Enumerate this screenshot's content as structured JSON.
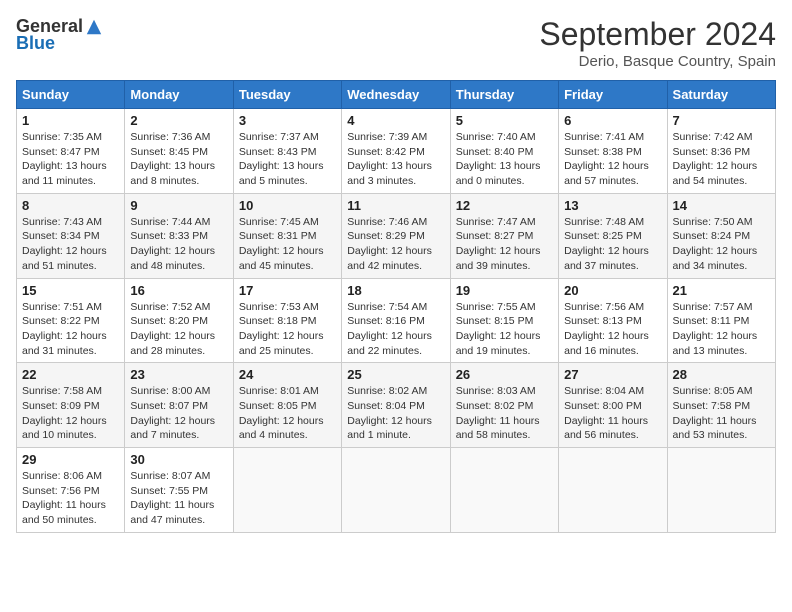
{
  "logo": {
    "general": "General",
    "blue": "Blue"
  },
  "title": "September 2024",
  "subtitle": "Derio, Basque Country, Spain",
  "headers": [
    "Sunday",
    "Monday",
    "Tuesday",
    "Wednesday",
    "Thursday",
    "Friday",
    "Saturday"
  ],
  "weeks": [
    [
      {
        "day": "1",
        "sunrise": "Sunrise: 7:35 AM",
        "sunset": "Sunset: 8:47 PM",
        "daylight": "Daylight: 13 hours and 11 minutes."
      },
      {
        "day": "2",
        "sunrise": "Sunrise: 7:36 AM",
        "sunset": "Sunset: 8:45 PM",
        "daylight": "Daylight: 13 hours and 8 minutes."
      },
      {
        "day": "3",
        "sunrise": "Sunrise: 7:37 AM",
        "sunset": "Sunset: 8:43 PM",
        "daylight": "Daylight: 13 hours and 5 minutes."
      },
      {
        "day": "4",
        "sunrise": "Sunrise: 7:39 AM",
        "sunset": "Sunset: 8:42 PM",
        "daylight": "Daylight: 13 hours and 3 minutes."
      },
      {
        "day": "5",
        "sunrise": "Sunrise: 7:40 AM",
        "sunset": "Sunset: 8:40 PM",
        "daylight": "Daylight: 13 hours and 0 minutes."
      },
      {
        "day": "6",
        "sunrise": "Sunrise: 7:41 AM",
        "sunset": "Sunset: 8:38 PM",
        "daylight": "Daylight: 12 hours and 57 minutes."
      },
      {
        "day": "7",
        "sunrise": "Sunrise: 7:42 AM",
        "sunset": "Sunset: 8:36 PM",
        "daylight": "Daylight: 12 hours and 54 minutes."
      }
    ],
    [
      {
        "day": "8",
        "sunrise": "Sunrise: 7:43 AM",
        "sunset": "Sunset: 8:34 PM",
        "daylight": "Daylight: 12 hours and 51 minutes."
      },
      {
        "day": "9",
        "sunrise": "Sunrise: 7:44 AM",
        "sunset": "Sunset: 8:33 PM",
        "daylight": "Daylight: 12 hours and 48 minutes."
      },
      {
        "day": "10",
        "sunrise": "Sunrise: 7:45 AM",
        "sunset": "Sunset: 8:31 PM",
        "daylight": "Daylight: 12 hours and 45 minutes."
      },
      {
        "day": "11",
        "sunrise": "Sunrise: 7:46 AM",
        "sunset": "Sunset: 8:29 PM",
        "daylight": "Daylight: 12 hours and 42 minutes."
      },
      {
        "day": "12",
        "sunrise": "Sunrise: 7:47 AM",
        "sunset": "Sunset: 8:27 PM",
        "daylight": "Daylight: 12 hours and 39 minutes."
      },
      {
        "day": "13",
        "sunrise": "Sunrise: 7:48 AM",
        "sunset": "Sunset: 8:25 PM",
        "daylight": "Daylight: 12 hours and 37 minutes."
      },
      {
        "day": "14",
        "sunrise": "Sunrise: 7:50 AM",
        "sunset": "Sunset: 8:24 PM",
        "daylight": "Daylight: 12 hours and 34 minutes."
      }
    ],
    [
      {
        "day": "15",
        "sunrise": "Sunrise: 7:51 AM",
        "sunset": "Sunset: 8:22 PM",
        "daylight": "Daylight: 12 hours and 31 minutes."
      },
      {
        "day": "16",
        "sunrise": "Sunrise: 7:52 AM",
        "sunset": "Sunset: 8:20 PM",
        "daylight": "Daylight: 12 hours and 28 minutes."
      },
      {
        "day": "17",
        "sunrise": "Sunrise: 7:53 AM",
        "sunset": "Sunset: 8:18 PM",
        "daylight": "Daylight: 12 hours and 25 minutes."
      },
      {
        "day": "18",
        "sunrise": "Sunrise: 7:54 AM",
        "sunset": "Sunset: 8:16 PM",
        "daylight": "Daylight: 12 hours and 22 minutes."
      },
      {
        "day": "19",
        "sunrise": "Sunrise: 7:55 AM",
        "sunset": "Sunset: 8:15 PM",
        "daylight": "Daylight: 12 hours and 19 minutes."
      },
      {
        "day": "20",
        "sunrise": "Sunrise: 7:56 AM",
        "sunset": "Sunset: 8:13 PM",
        "daylight": "Daylight: 12 hours and 16 minutes."
      },
      {
        "day": "21",
        "sunrise": "Sunrise: 7:57 AM",
        "sunset": "Sunset: 8:11 PM",
        "daylight": "Daylight: 12 hours and 13 minutes."
      }
    ],
    [
      {
        "day": "22",
        "sunrise": "Sunrise: 7:58 AM",
        "sunset": "Sunset: 8:09 PM",
        "daylight": "Daylight: 12 hours and 10 minutes."
      },
      {
        "day": "23",
        "sunrise": "Sunrise: 8:00 AM",
        "sunset": "Sunset: 8:07 PM",
        "daylight": "Daylight: 12 hours and 7 minutes."
      },
      {
        "day": "24",
        "sunrise": "Sunrise: 8:01 AM",
        "sunset": "Sunset: 8:05 PM",
        "daylight": "Daylight: 12 hours and 4 minutes."
      },
      {
        "day": "25",
        "sunrise": "Sunrise: 8:02 AM",
        "sunset": "Sunset: 8:04 PM",
        "daylight": "Daylight: 12 hours and 1 minute."
      },
      {
        "day": "26",
        "sunrise": "Sunrise: 8:03 AM",
        "sunset": "Sunset: 8:02 PM",
        "daylight": "Daylight: 11 hours and 58 minutes."
      },
      {
        "day": "27",
        "sunrise": "Sunrise: 8:04 AM",
        "sunset": "Sunset: 8:00 PM",
        "daylight": "Daylight: 11 hours and 56 minutes."
      },
      {
        "day": "28",
        "sunrise": "Sunrise: 8:05 AM",
        "sunset": "Sunset: 7:58 PM",
        "daylight": "Daylight: 11 hours and 53 minutes."
      }
    ],
    [
      {
        "day": "29",
        "sunrise": "Sunrise: 8:06 AM",
        "sunset": "Sunset: 7:56 PM",
        "daylight": "Daylight: 11 hours and 50 minutes."
      },
      {
        "day": "30",
        "sunrise": "Sunrise: 8:07 AM",
        "sunset": "Sunset: 7:55 PM",
        "daylight": "Daylight: 11 hours and 47 minutes."
      },
      null,
      null,
      null,
      null,
      null
    ]
  ]
}
